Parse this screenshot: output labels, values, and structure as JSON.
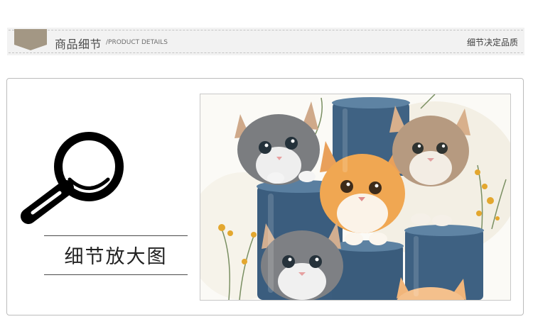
{
  "header": {
    "title_cn": "商品细节",
    "title_en": "/PRODUCT DETAILS",
    "slogan": "细节决定品质"
  },
  "detail": {
    "label": "细节放大图"
  },
  "colors": {
    "ribbon": "#a39784",
    "header_bg": "#f2f2f2",
    "bucket_blue": "#3d5f7f",
    "card_border": "#bcbcbc"
  },
  "icons": [
    "ribbon-icon",
    "magnifier-icon"
  ]
}
